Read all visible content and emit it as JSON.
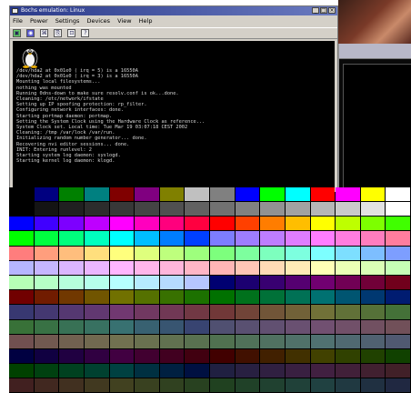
{
  "window": {
    "title": "Bochs emulation: Linux",
    "minimize": "_",
    "maximize": "□",
    "close": "×"
  },
  "menu": [
    "File",
    "Power",
    "Settings",
    "Devices",
    "View",
    "Help"
  ],
  "toolbar": {
    "tools": [
      {
        "name": "floppy-icon",
        "glyph": "▣"
      },
      {
        "name": "cdrom-icon",
        "glyph": "◉"
      },
      {
        "name": "mouse-icon",
        "glyph": "⌘"
      },
      {
        "name": "copy-icon",
        "glyph": "⎘"
      },
      {
        "name": "snapshot-icon",
        "glyph": "⊡"
      },
      {
        "name": "help-icon",
        "glyph": "?"
      }
    ]
  },
  "console": {
    "lines": [
      "/dev/hda2 at 0x01e0 ( irq = 5) is a 16550A",
      "/dev/hda2 at 0x01e0 ( irq = 3) is a 16550A",
      "Mounting local filesystems...",
      "nothing was mounted",
      "Running 0dns-down to make sure resolv.conf is ok...done.",
      "Cleaning: /etc/network/ifstate",
      "Setting up IP spoofing protection: rp_filter.",
      "Configuring network interfaces: done.",
      "Starting portmap daemon: portmap.",
      "",
      "Setting the System Clock using the Hardware Clock as reference...",
      "System Clock set. Local time: Tue Mar 19 03:07:18 CEST 2002",
      "",
      "Cleaning: /tmp /var/lock /var/run.",
      "Initializing random number generator... done.",
      "Recovering nvi editor sessions... done.",
      "INIT: Entering runlevel: 2",
      "Starting system log daemon: syslogd.",
      "Starting kernel log daemon: klogd."
    ]
  },
  "palette": {
    "rows": [
      [
        "#000000",
        "#000080",
        "#008000",
        "#008080",
        "#800000",
        "#800080",
        "#808000",
        "#c0c0c0",
        "#808080",
        "#0000ff",
        "#00ff00",
        "#00ffff",
        "#ff0000",
        "#ff00ff",
        "#ffff00",
        "#ffffff"
      ],
      [
        "#000000",
        "#141414",
        "#202020",
        "#2c2c2c",
        "#383838",
        "#444444",
        "#505050",
        "#616161",
        "#717171",
        "#818181",
        "#929292",
        "#a2a2a2",
        "#b6b6b6",
        "#cacaca",
        "#e2e2e2",
        "#ffffff"
      ],
      [
        "#0000ff",
        "#4000ff",
        "#7d00ff",
        "#be00ff",
        "#ff00ff",
        "#ff00be",
        "#ff007d",
        "#ff0040",
        "#ff0000",
        "#ff4000",
        "#ff7d00",
        "#ffbe00",
        "#ffff00",
        "#beff00",
        "#7dff00",
        "#40ff00"
      ],
      [
        "#00ff00",
        "#00ff40",
        "#00ff7d",
        "#00ffbe",
        "#00ffff",
        "#00beff",
        "#007dff",
        "#0040ff",
        "#7d7dff",
        "#9e7dff",
        "#be7dff",
        "#df7dff",
        "#ff7dff",
        "#ff7ddf",
        "#ff7dbe",
        "#ff7d9e"
      ],
      [
        "#ff7d7d",
        "#ff9e7d",
        "#ffbe7d",
        "#ffdf7d",
        "#ffff7d",
        "#dfff7d",
        "#beff7d",
        "#9eff7d",
        "#7dff7d",
        "#7dff9e",
        "#7dffbe",
        "#7dffdf",
        "#7dffff",
        "#7ddfff",
        "#7dbeff",
        "#7d9eff"
      ],
      [
        "#b6b6ff",
        "#c6b6ff",
        "#dbb6ff",
        "#ebb6ff",
        "#ffb6ff",
        "#ffb6eb",
        "#ffb6db",
        "#ffb6c6",
        "#ffb6b6",
        "#ffc6b6",
        "#ffdbb6",
        "#ffebb6",
        "#ffffb6",
        "#ebffb6",
        "#dbffb6",
        "#c6ffb6"
      ],
      [
        "#b6ffb6",
        "#b6ffc6",
        "#b6ffdb",
        "#b6ffeb",
        "#b6ffff",
        "#b6ebff",
        "#b6dbff",
        "#b6c6ff",
        "#000071",
        "#1c0071",
        "#380071",
        "#550071",
        "#710071",
        "#710055",
        "#710038",
        "#71001c"
      ],
      [
        "#710000",
        "#711c00",
        "#713800",
        "#715500",
        "#717100",
        "#557100",
        "#387100",
        "#1c7100",
        "#007100",
        "#00711c",
        "#007138",
        "#007155",
        "#007171",
        "#005571",
        "#003871",
        "#001c71"
      ],
      [
        "#383871",
        "#443871",
        "#553871",
        "#613871",
        "#713871",
        "#713861",
        "#713855",
        "#713844",
        "#713838",
        "#714438",
        "#715538",
        "#716138",
        "#717138",
        "#617138",
        "#557138",
        "#447138"
      ],
      [
        "#387138",
        "#387144",
        "#387155",
        "#387161",
        "#387171",
        "#386171",
        "#385571",
        "#384471",
        "#505071",
        "#595071",
        "#615071",
        "#695071",
        "#715071",
        "#715069",
        "#715061",
        "#715059"
      ],
      [
        "#715050",
        "#715950",
        "#716150",
        "#716950",
        "#717150",
        "#697150",
        "#617150",
        "#597150",
        "#507150",
        "#507159",
        "#507161",
        "#507169",
        "#507171",
        "#506971",
        "#506171",
        "#505971"
      ],
      [
        "#000041",
        "#100041",
        "#200041",
        "#300041",
        "#410041",
        "#410030",
        "#410020",
        "#410010",
        "#410000",
        "#411000",
        "#412000",
        "#413000",
        "#414100",
        "#304100",
        "#204100",
        "#104100"
      ],
      [
        "#004100",
        "#004110",
        "#004120",
        "#004130",
        "#004141",
        "#003041",
        "#002041",
        "#001041",
        "#202041",
        "#282041",
        "#302041",
        "#392041",
        "#412041",
        "#412039",
        "#412030",
        "#412028"
      ],
      [
        "#412020",
        "#412820",
        "#413020",
        "#413920",
        "#414120",
        "#394120",
        "#304120",
        "#284120",
        "#204120",
        "#204128",
        "#204130",
        "#204139",
        "#204141",
        "#203941",
        "#203041",
        "#202841"
      ]
    ]
  }
}
